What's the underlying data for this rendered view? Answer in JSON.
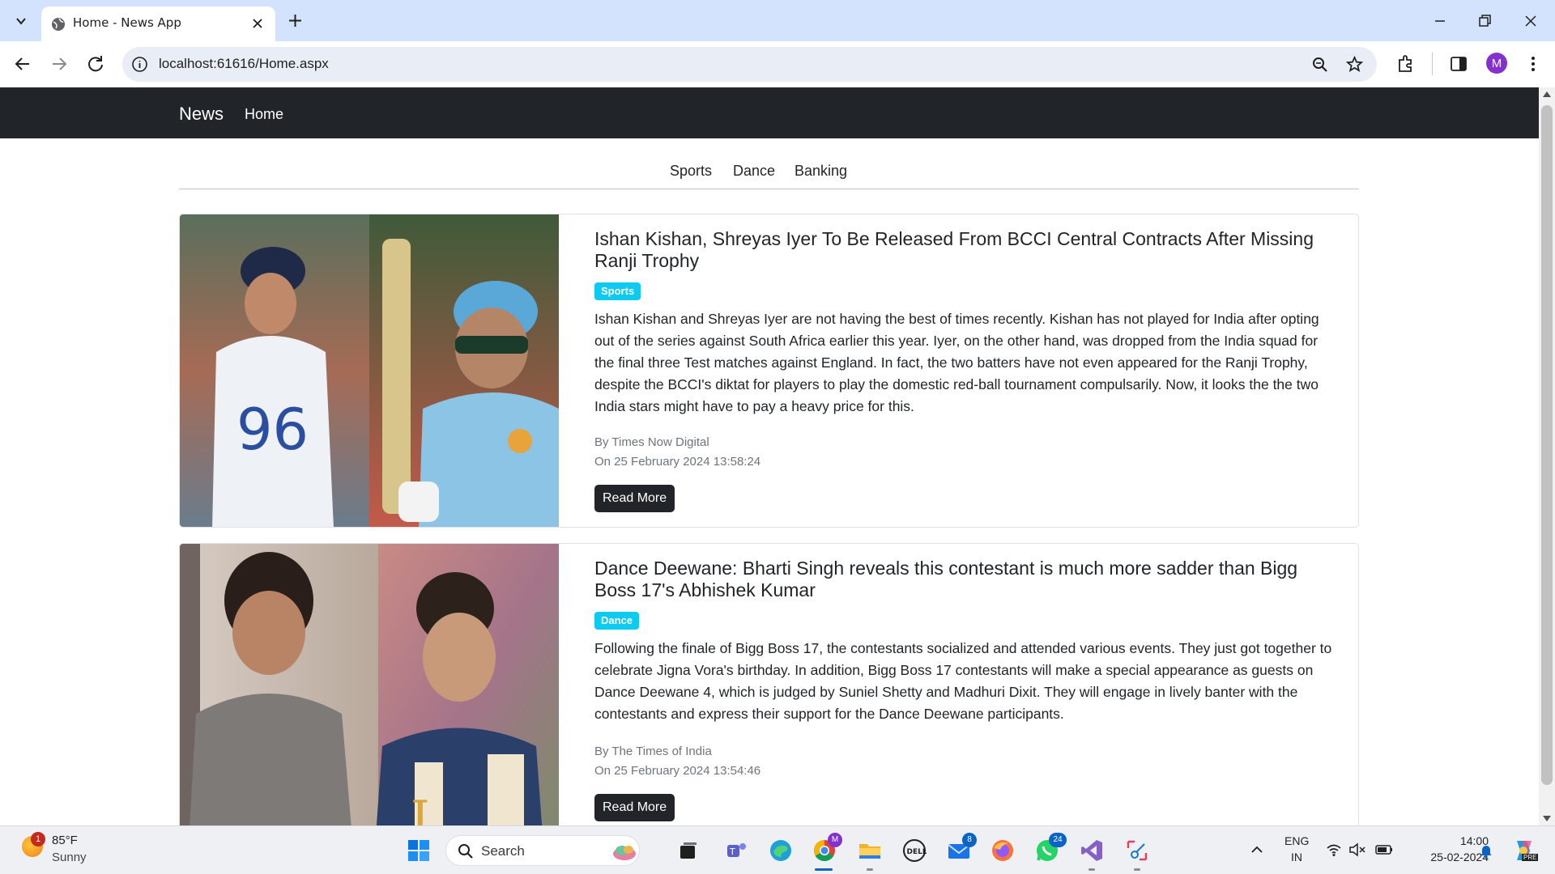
{
  "browser": {
    "tab_title": "Home - News App",
    "url": "localhost:61616/Home.aspx",
    "profile_initial": "M"
  },
  "site": {
    "brand": "News",
    "nav_home": "Home",
    "categories": [
      "Sports",
      "Dance",
      "Banking"
    ]
  },
  "articles": [
    {
      "title": "Ishan Kishan, Shreyas Iyer To Be Released From BCCI Central Contracts After Missing Ranji Trophy",
      "category": "Sports",
      "description": "Ishan Kishan and Shreyas Iyer are not having the best of times recently. Kishan has not played for India after opting out of the series against South Africa earlier this year. Iyer, on the other hand, was dropped from the India squad for the final three Test matches against England. In fact, the two batters have not even appeared for the Ranji Trophy, despite the BCCI's diktat for players to play the domestic red-ball tournament compulsarily. Now, it looks the the two India stars might have to pay a heavy price for this.",
      "author": "By Times Now Digital",
      "date": "On 25 February 2024 13:58:24",
      "read_more": "Read More"
    },
    {
      "title": "Dance Deewane: Bharti Singh reveals this contestant is much more sadder than Bigg Boss 17's Abhishek Kumar",
      "category": "Dance",
      "description": "Following the finale of Bigg Boss 17, the contestants socialized and attended various events. They just got together to celebrate Jigna Vora's birthday. In addition, Bigg Boss 17 contestants will make a special appearance as guests on Dance Deewane 4, which is judged by Suniel Shetty and Madhuri Dixit. They will engage in lively banter with the contestants and express their support for the Dance Deewane participants.",
      "author": "By The Times of India",
      "date": "On 25 February 2024 13:54:46",
      "read_more": "Read More"
    }
  ],
  "taskbar": {
    "weather_temp": "85°F",
    "weather_cond": "Sunny",
    "weather_badge": "1",
    "search_label": "Search",
    "chrome_badge": "M",
    "mail_badge": "8",
    "whatsapp_badge": "24",
    "lang_line1": "ENG",
    "lang_line2": "IN",
    "time": "14:00",
    "date": "25-02-2024",
    "copilot_label": "PRE"
  },
  "colors": {
    "navbar_bg": "#212529",
    "badge_bg": "#0dcaf0",
    "button_bg": "#212529",
    "tabstrip_bg": "#d3e3fd"
  }
}
